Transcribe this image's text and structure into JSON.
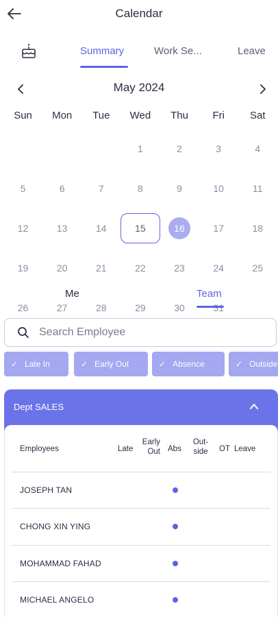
{
  "header": {
    "title": "Calendar"
  },
  "tabs": {
    "items": [
      "Summary",
      "Work Se...",
      "Leave"
    ],
    "active": "Summary"
  },
  "calendar": {
    "month": "May 2024",
    "weekdays": [
      "Sun",
      "Mon",
      "Tue",
      "Wed",
      "Thu",
      "Fri",
      "Sat"
    ],
    "weeks": [
      [
        "",
        "",
        "",
        "1",
        "2",
        "3",
        "4"
      ],
      [
        "5",
        "6",
        "7",
        "8",
        "9",
        "10",
        "11"
      ],
      [
        "12",
        "13",
        "14",
        "15",
        "16",
        "17",
        "18"
      ],
      [
        "19",
        "20",
        "21",
        "22",
        "23",
        "24",
        "25"
      ],
      [
        "26",
        "27",
        "28",
        "29",
        "30",
        "31",
        ""
      ]
    ],
    "selected_day": "15",
    "today": "16"
  },
  "view_toggle": {
    "me": "Me",
    "team": "Team",
    "active": "Team"
  },
  "search": {
    "placeholder": "Search Employee",
    "value": ""
  },
  "filters": [
    "Late In",
    "Early Out",
    "Absence",
    "Outside"
  ],
  "department": {
    "title": "Dept SALES",
    "columns": {
      "employees": "Employees",
      "late": "Late",
      "early_out_1": "Early",
      "early_out_2": "Out",
      "abs": "Abs",
      "outside_1": "Out-",
      "outside_2": "side",
      "ot": "OT",
      "leave": "Leave"
    },
    "employees": [
      {
        "name": "JOSEPH TAN",
        "abs": true
      },
      {
        "name": "CHONG XIN YING",
        "abs": true
      },
      {
        "name": "MOHAMMAD FAHAD",
        "abs": true
      },
      {
        "name": "MICHAEL ANGELO",
        "abs": true
      }
    ]
  },
  "colors": {
    "accent": "#5c65e0",
    "chip": "#a3a8f0",
    "dept_header": "#6b73e8",
    "today_circle": "#a9adee"
  }
}
